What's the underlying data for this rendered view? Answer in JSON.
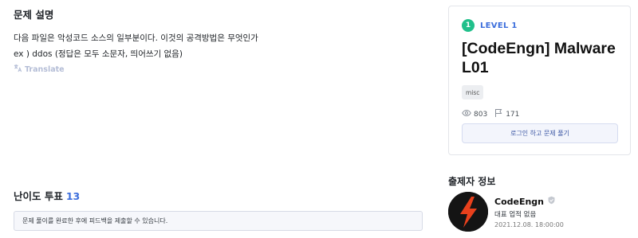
{
  "description": {
    "heading": "문제 설명",
    "line1": "다음 파일은 악성코드 소스의 일부분이다. 이것의 공격방법은 무엇인가",
    "line2": "ex ) ddos (정답은 모두 소문자, 띄어쓰기 없음)",
    "translate_label": "Translate"
  },
  "vote": {
    "heading": "난이도 투표",
    "count": "13",
    "notice": "문제 풀이를 완료한 후에 피드백을 제출할 수 있습니다."
  },
  "challenge": {
    "level_number": "1",
    "level_label": "LEVEL 1",
    "title": "[CodeEngn] Malware L01",
    "tag": "misc",
    "views": "803",
    "comments": "171",
    "login_button": "로그인 하고 문제 풀기"
  },
  "author": {
    "heading": "출제자 정보",
    "name": "CodeEngn",
    "subtitle": "대표 업적 없음",
    "date": "2021.12.08. 18:00:00"
  },
  "colors": {
    "accent": "#3c6edc",
    "level_badge": "#21c08b",
    "avatar_bolt": "#e8401c"
  }
}
